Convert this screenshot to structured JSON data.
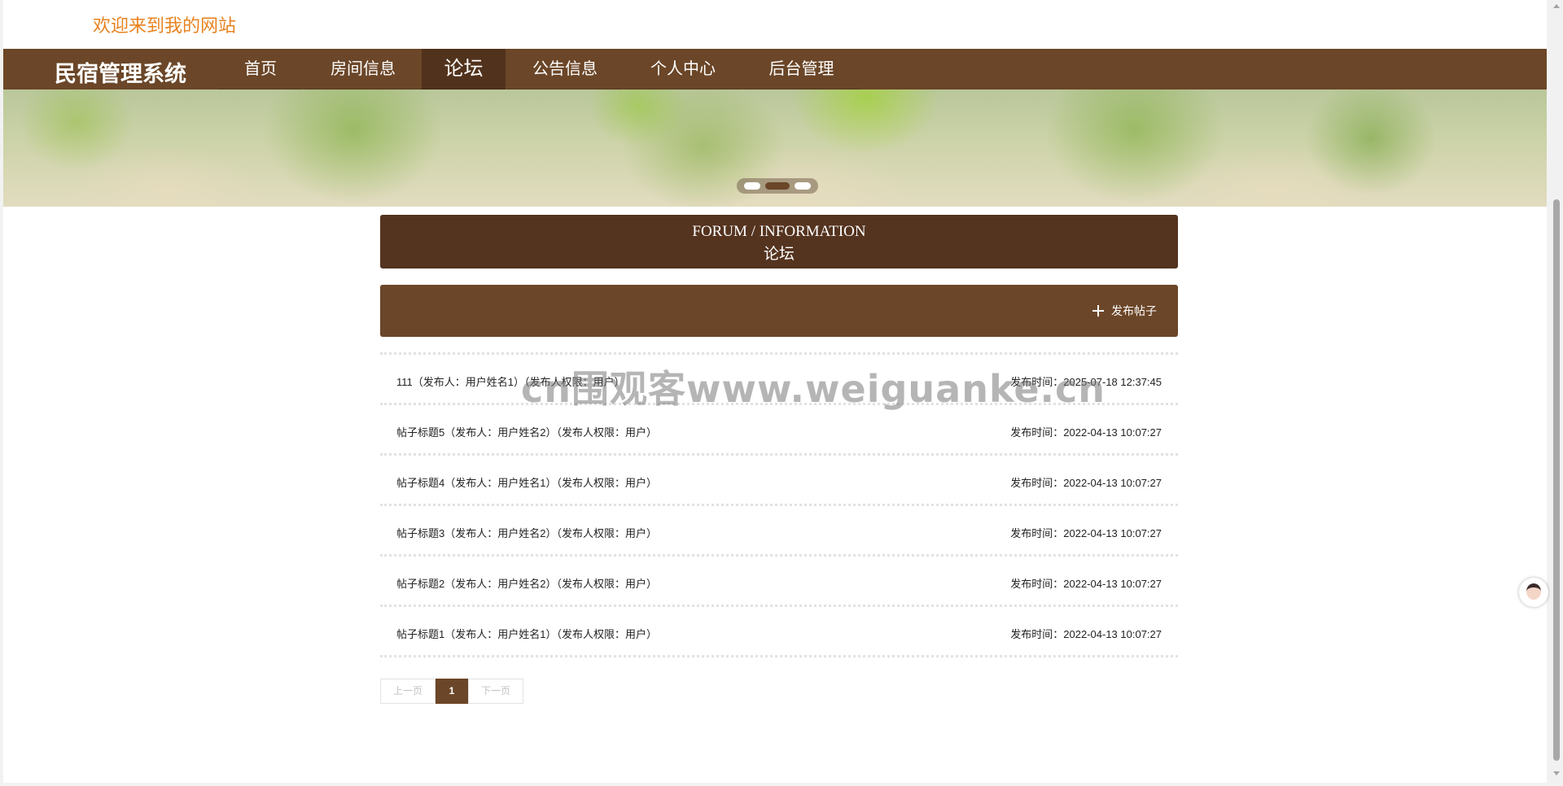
{
  "header": {
    "welcome": "欢迎来到我的网站"
  },
  "navbar": {
    "brand": "民宿管理系统",
    "items": [
      {
        "label": "首页"
      },
      {
        "label": "房间信息"
      },
      {
        "label": "论坛",
        "active": true
      },
      {
        "label": "公告信息"
      },
      {
        "label": "个人中心"
      },
      {
        "label": "后台管理"
      }
    ]
  },
  "banner": {
    "dot_count": 3,
    "active_dot": 2
  },
  "section": {
    "title_en": "FORUM / INFORMATION",
    "title_cn": "论坛"
  },
  "toolbar": {
    "publish_label": "发布帖子"
  },
  "posts": [
    {
      "title": "111（发布人：用户姓名1）（发布人权限：用户）",
      "time": "发布时间：2025-07-18 12:37:45"
    },
    {
      "title": "帖子标题5（发布人：用户姓名2）（发布人权限：用户）",
      "time": "发布时间：2022-04-13 10:07:27"
    },
    {
      "title": "帖子标题4（发布人：用户姓名1）（发布人权限：用户）",
      "time": "发布时间：2022-04-13 10:07:27"
    },
    {
      "title": "帖子标题3（发布人：用户姓名2）（发布人权限：用户）",
      "time": "发布时间：2022-04-13 10:07:27"
    },
    {
      "title": "帖子标题2（发布人：用户姓名2）（发布人权限：用户）",
      "time": "发布时间：2022-04-13 10:07:27"
    },
    {
      "title": "帖子标题1（发布人：用户姓名1）（发布人权限：用户）",
      "time": "发布时间：2022-04-13 10:07:27"
    }
  ],
  "pagination": {
    "prev": "上一页",
    "current": "1",
    "next": "下一页"
  },
  "watermark": "cn围观客www.weiguanke.cn",
  "colors": {
    "primary": "#6b4628",
    "dark": "#54331f",
    "welcome": "#e8821f"
  }
}
